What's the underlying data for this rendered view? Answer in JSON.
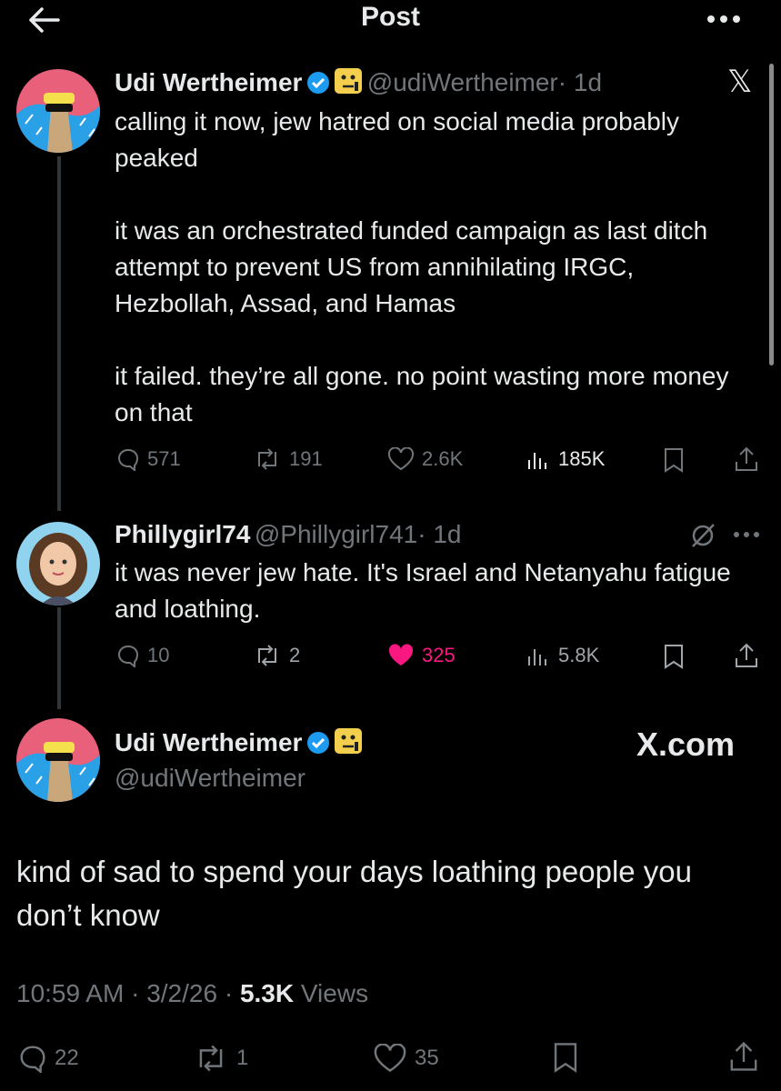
{
  "header": {
    "title": "Post"
  },
  "post1": {
    "name": "Udi Wertheimer",
    "handle": "@udiWertheimer",
    "time": "· 1d",
    "logo": "𝕏",
    "text": "calling it now, jew hatred on social media probably peaked\n\nit was an orchestrated funded campaign as last ditch attempt to prevent US from annihilating IRGC, Hezbollah, Assad, and Hamas\n\nit failed. they’re all gone. no point wasting more money on that",
    "replies": "571",
    "reposts": "191",
    "likes": "2.6K",
    "views": "185K"
  },
  "post2": {
    "name": "Phillygirl74",
    "handle": "@Phillygirl741",
    "time": "· 1d",
    "text": "it was never jew hate. It's Israel and Netanyahu fatigue and loathing.",
    "replies": "10",
    "reposts": "2",
    "likes": "325",
    "views": "5.8K"
  },
  "main": {
    "name": "Udi Wertheimer",
    "handle": "@udiWertheimer",
    "source": "X.com",
    "text": "kind of sad to spend your days loathing people you don’t know",
    "time": "10:59 AM",
    "date": "3/2/26",
    "views_count": "5.3K",
    "views_label": "Views",
    "replies": "22",
    "reposts": "1",
    "likes": "35"
  },
  "colors": {
    "like": "#f91880",
    "verified": "#1d9bf0",
    "muted": "#71767b"
  },
  "icons": [
    "back-arrow-icon",
    "more-icon",
    "verified-icon",
    "emoji-badge-icon",
    "x-logo-icon",
    "reply-icon",
    "repost-icon",
    "like-icon",
    "views-icon",
    "bookmark-icon",
    "share-icon",
    "grok-icon"
  ]
}
